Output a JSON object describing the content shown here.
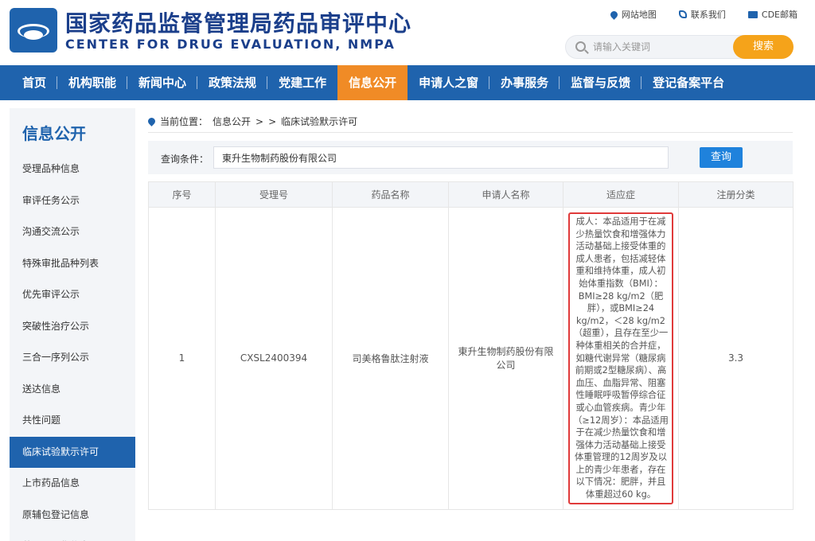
{
  "header": {
    "title_cn": "国家药品监督管理局药品审评中心",
    "title_en": "CENTER FOR DRUG EVALUATION, NMPA",
    "links": [
      {
        "icon": "map-pin-icon",
        "label": "网站地图"
      },
      {
        "icon": "phone-icon",
        "label": "联系我们"
      },
      {
        "icon": "mail-icon",
        "label": "CDE邮箱"
      }
    ],
    "search_placeholder": "请输入关键词",
    "search_button": "搜索"
  },
  "nav": {
    "items": [
      "首页",
      "机构职能",
      "新闻中心",
      "政策法规",
      "党建工作",
      "信息公开",
      "申请人之窗",
      "办事服务",
      "监督与反馈",
      "登记备案平台"
    ],
    "active": "信息公开"
  },
  "sidebar": {
    "title": "信息公开",
    "items": [
      "受理品种信息",
      "审评任务公示",
      "沟通交流公示",
      "特殊审批品种列表",
      "优先审评公示",
      "突破性治疗公示",
      "三合一序列公示",
      "送达信息",
      "共性问题",
      "临床试验默示许可",
      "上市药品信息",
      "原辅包登记信息",
      "药品目录集信息"
    ],
    "active": "临床试验默示许可"
  },
  "breadcrumb": {
    "label": "当前位置：",
    "path": [
      "信息公开",
      ">",
      ">",
      "临床试验默示许可"
    ]
  },
  "query": {
    "label": "查询条件：",
    "value": "東升生物制药股份有限公司",
    "button": "查询"
  },
  "table": {
    "columns": [
      "序号",
      "受理号",
      "药品名称",
      "申请人名称",
      "适应症",
      "注册分类"
    ],
    "rows": [
      {
        "index": "1",
        "acceptance_no": "CXSL2400394",
        "drug_name": "司美格鲁肽注射液",
        "applicant": "東升生物制药股份有限公司",
        "indication": "成人：本品适用于在减少热量饮食和增强体力活动基础上接受体重的成人患者，包括减轻体重和维持体重，成人初始体重指数（BMI）：BMI≥28 kg/m2（肥胖），或BMI≥24 kg/m2，＜28 kg/m2（超重），且存在至少一种体重相关的合并症，如糖代谢异常（糖尿病前期或2型糖尿病）、高血压、血脂异常、阻塞性睡眠呼吸暂停综合征或心血管疾病。青少年（≥12周岁）：本品适用于在减少热量饮食和增强体力活动基础上接受体重管理的12周岁及以上的青少年患者，存在以下情况：肥胖，并且体重超过60 kg。",
        "reg_class": "3.3"
      }
    ]
  },
  "colors": {
    "brand_blue": "#1f63ad",
    "nav_active": "#f08b26",
    "search_button": "#f5a31a",
    "highlight_border": "#e03a3a"
  }
}
